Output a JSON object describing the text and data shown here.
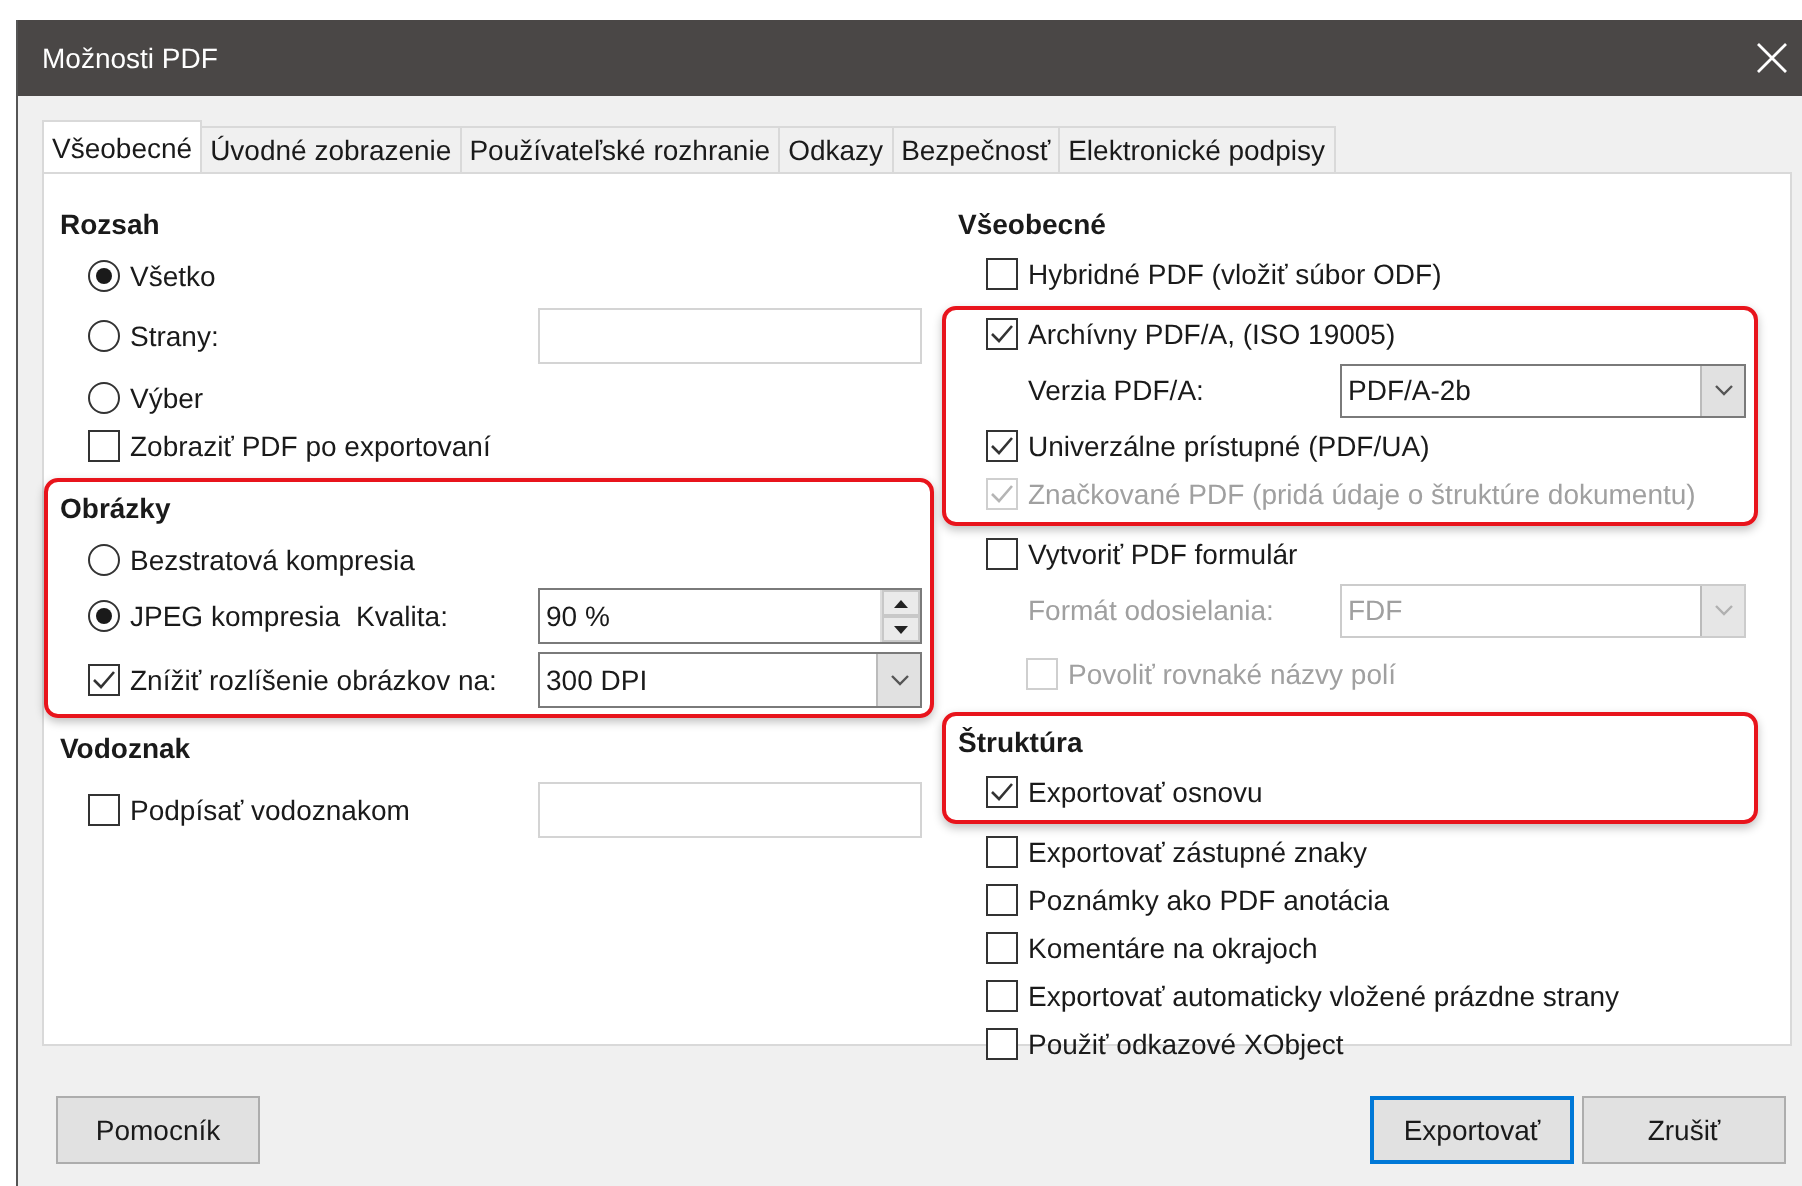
{
  "window": {
    "title": "Možnosti PDF"
  },
  "tabs": [
    {
      "label": "Všeobecné",
      "selected": true
    },
    {
      "label": "Úvodné zobrazenie",
      "selected": false
    },
    {
      "label": "Používateľské rozhranie",
      "selected": false
    },
    {
      "label": "Odkazy",
      "selected": false
    },
    {
      "label": "Bezpečnosť",
      "selected": false
    },
    {
      "label": "Elektronické podpisy",
      "selected": false
    }
  ],
  "left_column": [
    {
      "blocks": [
        {
          "highlighted": false,
          "title": "Rozsah",
          "rows": [
            {
              "kind": "radio",
              "label": "Všetko",
              "selected": true
            },
            {
              "kind": "radio_field",
              "label": "Strany:",
              "selected": false
            },
            {
              "kind": "radio",
              "label": "Výber",
              "selected": false
            },
            {
              "kind": "checkbox",
              "label": "Zobraziť PDF po exportovaní",
              "checked": false,
              "disabled": false
            }
          ]
        }
      ]
    },
    {
      "blocks": [
        {
          "highlighted": true,
          "title": "Obrázky",
          "rows": [
            {
              "kind": "radio",
              "label": "Bezstratová kompresia",
              "selected": false
            },
            {
              "kind": "radio_spin",
              "label": "JPEG kompresia",
              "field_label": "Kvalita:",
              "value": "90 %",
              "selected": true
            },
            {
              "kind": "checkbox_combo",
              "label": "Znížiť rozlíšenie obrázkov na:",
              "value": "300 DPI",
              "checked": true
            }
          ]
        }
      ]
    },
    {
      "blocks": [
        {
          "highlighted": false,
          "title": "Vodoznak",
          "rows": [
            {
              "kind": "checkbox_field",
              "label": "Podpísať vodoznakom",
              "checked": false
            }
          ]
        }
      ]
    }
  ],
  "right_column": [
    {
      "blocks": [
        {
          "highlighted": false,
          "title": "Všeobecné",
          "rows": [
            {
              "kind": "checkbox",
              "label": "Hybridné PDF (vložiť súbor ODF)",
              "checked": false,
              "disabled": false
            }
          ]
        },
        {
          "highlighted": true,
          "rows": [
            {
              "kind": "checkbox",
              "label": "Archívny PDF/A, (ISO 19005)",
              "checked": true,
              "disabled": false
            },
            {
              "kind": "combo",
              "label": "Verzia PDF/A:",
              "value": "PDF/A-2b",
              "disabled": false
            },
            {
              "kind": "checkbox",
              "label": "Univerzálne prístupné (PDF/UA)",
              "checked": true,
              "disabled": false
            },
            {
              "kind": "checkbox",
              "label": "Značkované PDF (pridá údaje o štruktúre dokumentu)",
              "checked": true,
              "disabled": true
            }
          ]
        },
        {
          "highlighted": false,
          "rows": [
            {
              "kind": "checkbox",
              "label": "Vytvoriť PDF formulár",
              "checked": false,
              "disabled": false
            },
            {
              "kind": "combo",
              "label": "Formát odosielania:",
              "value": "FDF",
              "disabled": true
            },
            {
              "kind": "checkbox",
              "label": "Povoliť rovnaké názvy polí",
              "checked": false,
              "disabled": true,
              "indented": true
            }
          ]
        }
      ]
    },
    {
      "blocks": [
        {
          "highlighted": true,
          "title": "Štruktúra",
          "rows": [
            {
              "kind": "checkbox",
              "label": "Exportovať osnovu",
              "checked": true,
              "disabled": false
            }
          ]
        },
        {
          "highlighted": false,
          "rows": [
            {
              "kind": "checkbox",
              "label": "Exportovať zástupné znaky",
              "checked": false,
              "disabled": false
            },
            {
              "kind": "checkbox",
              "label": "Poznámky ako PDF anotácia",
              "checked": false,
              "disabled": false
            },
            {
              "kind": "checkbox",
              "label": "Komentáre na okrajoch",
              "checked": false,
              "disabled": false
            },
            {
              "kind": "checkbox",
              "label": "Exportovať automaticky vložené prázdne strany",
              "checked": false,
              "disabled": false
            },
            {
              "kind": "checkbox",
              "label": "Použiť odkazové XObject",
              "checked": false,
              "disabled": false
            }
          ]
        }
      ]
    }
  ],
  "help_button": {
    "label": "Pomocník",
    "default": false
  },
  "action_buttons": [
    {
      "label": "Exportovať",
      "default": true
    },
    {
      "label": "Zrušiť",
      "default": false
    }
  ]
}
